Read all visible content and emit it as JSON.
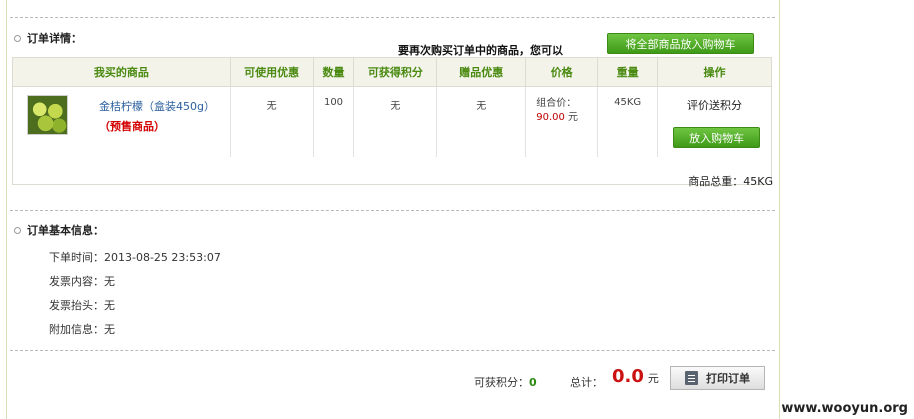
{
  "order_detail": {
    "title": "订单详情：",
    "reorder_text": "要再次购买订单中的商品，您可以",
    "reorder_all_button": "将全部商品放入购物车"
  },
  "table": {
    "headers": [
      "我买的商品",
      "可使用优惠",
      "数量",
      "可获得积分",
      "赠品优惠",
      "价格",
      "重量",
      "操作"
    ],
    "row": {
      "product_name": "金桔柠檬（盒装450g）",
      "presale_label": "（预售商品）",
      "usable_discount": "无",
      "quantity": "100",
      "points": "无",
      "gift_discount": "无",
      "price_prefix": "组合价：",
      "price_value": "90.00",
      "price_unit": "元",
      "weight": "45KG",
      "review_link": "评价送积分",
      "add_to_cart_button": "放入购物车"
    }
  },
  "total_weight": "商品总重：45KG",
  "basic_info": {
    "title": "订单基本信息：",
    "order_time": "下单时间：2013-08-25 23:53:07",
    "invoice_content": "发票内容：无",
    "invoice_title": "发票抬头：无",
    "extra_info": "附加信息：无"
  },
  "footer": {
    "points_label": "可获积分：",
    "points_value": "0",
    "total_label": "总计：",
    "total_value": "0.0",
    "total_unit": "元",
    "print_button": "打印订单"
  },
  "watermark": "www.wooyun.org",
  "colors": {
    "header_green": "#4a8a10",
    "button_green": "#3e9a17",
    "price_red": "#c00000",
    "total_red": "#cc1111"
  }
}
